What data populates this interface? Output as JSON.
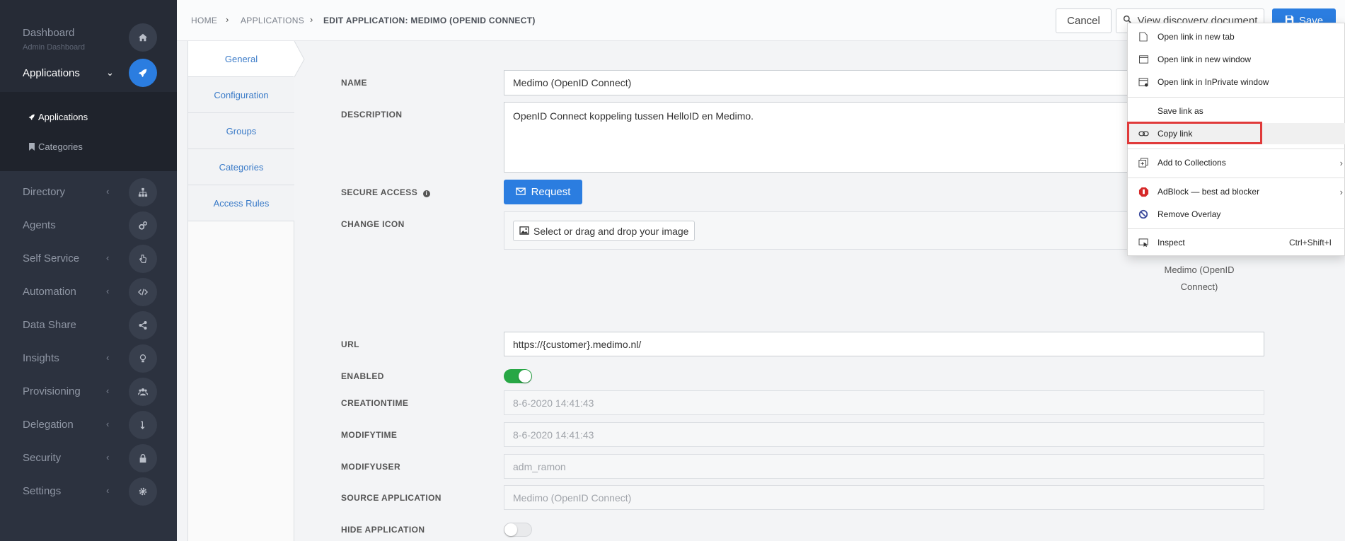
{
  "sidebar": {
    "dashboard": {
      "label": "Dashboard",
      "subtitle": "Admin Dashboard"
    },
    "applications": {
      "label": "Applications"
    },
    "sub_items": [
      {
        "label": "Applications"
      },
      {
        "label": "Categories"
      }
    ],
    "items": [
      {
        "label": "Directory"
      },
      {
        "label": "Agents"
      },
      {
        "label": "Self Service"
      },
      {
        "label": "Automation"
      },
      {
        "label": "Data Share"
      },
      {
        "label": "Insights"
      },
      {
        "label": "Provisioning"
      },
      {
        "label": "Delegation"
      },
      {
        "label": "Security"
      },
      {
        "label": "Settings"
      }
    ]
  },
  "header": {
    "breadcrumb": [
      "HOME",
      "APPLICATIONS",
      "EDIT APPLICATION: MEDIMO (OPENID CONNECT)"
    ],
    "cancel_label": "Cancel",
    "discovery_label": "View discovery document",
    "save_label": "Save"
  },
  "tabs": [
    {
      "label": "General"
    },
    {
      "label": "Configuration"
    },
    {
      "label": "Groups"
    },
    {
      "label": "Categories"
    },
    {
      "label": "Access Rules"
    }
  ],
  "form": {
    "name_label": "NAME",
    "name_value": "Medimo (OpenID Connect)",
    "description_label": "DESCRIPTION",
    "description_value": "OpenID Connect koppeling tussen HelloID en Medimo.",
    "secure_access_label": "SECURE ACCESS",
    "request_label": "Request",
    "change_icon_label": "CHANGE ICON",
    "select_image_label": "Select or drag and drop your image",
    "icon_caption": "Medimo (OpenID Connect)",
    "url_label": "URL",
    "url_value": "https://{customer}.medimo.nl/",
    "enabled_label": "ENABLED",
    "enabled": true,
    "creationtime_label": "CREATIONTIME",
    "creationtime_value": "8-6-2020 14:41:43",
    "modifytime_label": "MODIFYTIME",
    "modifytime_value": "8-6-2020 14:41:43",
    "modifyuser_label": "MODIFYUSER",
    "modifyuser_value": "adm_ramon",
    "source_label": "SOURCE APPLICATION",
    "source_value": "Medimo (OpenID Connect)",
    "hide_label": "HIDE APPLICATION",
    "hide": false
  },
  "context_menu": {
    "items": [
      {
        "label": "Open link in new tab"
      },
      {
        "label": "Open link in new window"
      },
      {
        "label": "Open link in InPrivate window"
      },
      {
        "label": "Save link as"
      },
      {
        "label": "Copy link"
      },
      {
        "label": "Add to Collections"
      },
      {
        "label": "AdBlock — best ad blocker"
      },
      {
        "label": "Remove Overlay"
      },
      {
        "label": "Inspect",
        "shortcut": "Ctrl+Shift+I"
      }
    ]
  },
  "colors": {
    "accent": "#2b7de0",
    "sidebar_bg": "#2c323f",
    "toggle_on": "#27a745",
    "highlight": "#e03a3a"
  }
}
